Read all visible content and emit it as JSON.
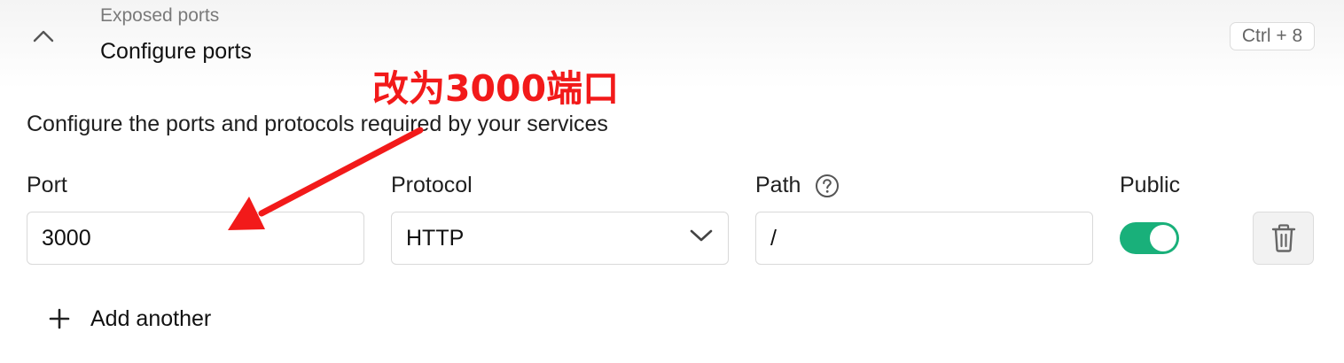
{
  "section": {
    "kicker": "Exposed ports",
    "title": "Configure ports",
    "shortcut": "Ctrl + 8",
    "description": "Configure the ports and protocols required by your services"
  },
  "annotation": {
    "text": "改为3000端口",
    "color": "#f21a1a"
  },
  "columns": {
    "port": "Port",
    "protocol": "Protocol",
    "path": "Path",
    "public": "Public"
  },
  "row": {
    "port_value": "3000",
    "protocol_value": "HTTP",
    "path_value": "/",
    "public_enabled": true
  },
  "actions": {
    "add_label": "Add another"
  },
  "icons": {
    "collapse": "chevron-up-icon",
    "help": "question-circle-icon",
    "dropdown": "chevron-down-icon",
    "delete": "trash-icon",
    "add": "plus-icon"
  },
  "colors": {
    "toggle_on": "#19b07a",
    "annotation": "#f21a1a"
  }
}
